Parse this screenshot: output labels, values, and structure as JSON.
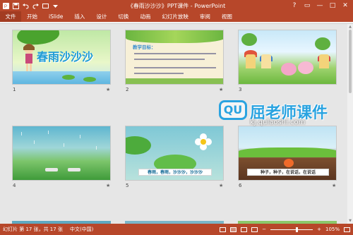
{
  "titlebar": {
    "title": "《春雨沙沙沙》PPT课件 - PowerPoint",
    "qat_icons": [
      "app-icon",
      "save-icon",
      "undo-icon",
      "redo-icon",
      "start-from-beginning-icon",
      "customize-icon"
    ],
    "window_controls": [
      "?",
      "▭",
      "—",
      "□",
      "✕"
    ]
  },
  "ribbon": {
    "file_label": "文件",
    "tabs": [
      "开始",
      "iSlide",
      "插入",
      "设计",
      "切换",
      "动画",
      "幻灯片放映",
      "审阅",
      "视图"
    ]
  },
  "slides": [
    {
      "number": "1",
      "title": "春雨沙沙沙",
      "has_animation": true
    },
    {
      "number": "2",
      "heading": "教学目标：",
      "has_animation": true
    },
    {
      "number": "3",
      "has_animation": false
    },
    {
      "number": "4",
      "has_animation": true
    },
    {
      "number": "5",
      "caption": "春雨，春雨，沙沙沙，沙沙沙",
      "has_animation": true
    },
    {
      "number": "6",
      "caption": "种子，种子，在说话，在说话",
      "has_animation": true
    }
  ],
  "star_glyph": "★",
  "watermark": {
    "logo_text": "QU",
    "brand_text": "屈老师课件",
    "url": "kj.qulaoshi.com"
  },
  "statusbar": {
    "slide_info": "幻灯片 第 17 张，共 17 张",
    "language": "中文(中国)",
    "zoom": "105%"
  },
  "colors": {
    "accent": "#b7472a",
    "watermark_blue": "#2aa3e0"
  }
}
